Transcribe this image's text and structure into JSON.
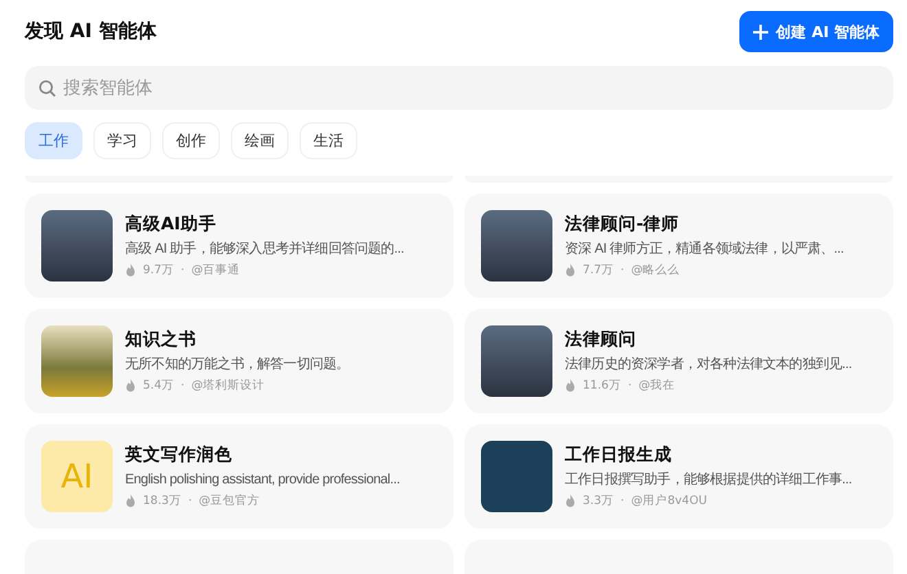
{
  "header": {
    "title": "发现 AI 智能体",
    "create_button": "创建 AI 智能体"
  },
  "search": {
    "placeholder": "搜索智能体"
  },
  "tabs": [
    {
      "label": "工作",
      "selected": true
    },
    {
      "label": "学习",
      "selected": false
    },
    {
      "label": "创作",
      "selected": false
    },
    {
      "label": "绘画",
      "selected": false
    },
    {
      "label": "生活",
      "selected": false
    }
  ],
  "agents": [
    {
      "kind": "photo",
      "title": "高级AI助手",
      "description": "高级 AI 助手，能够深入思考并详细回答问题的...",
      "uses": "9.7万",
      "separator": "·",
      "author": "@百事通"
    },
    {
      "kind": "photo",
      "title": "法律顾问-律师",
      "description": "资深 AI 律师方正，精通各领域法律，以严肃、...",
      "uses": "7.7万",
      "separator": "·",
      "author": "@略么么"
    },
    {
      "kind": "landscape",
      "title": "知识之书",
      "description": "无所不知的万能之书，解答一切问题。",
      "uses": "5.4万",
      "separator": "·",
      "author": "@塔利斯设计"
    },
    {
      "kind": "photo",
      "title": "法律顾问",
      "description": "法律历史的资深学者，对各种法律文本的独到见...",
      "uses": "11.6万",
      "separator": "·",
      "author": "@我在"
    },
    {
      "kind": "logo",
      "logo_text": "AI",
      "title": "英文写作润色",
      "description": "English polishing assistant, provide professional...",
      "uses": "18.3万",
      "separator": "·",
      "author": "@豆包官方"
    },
    {
      "kind": "robot",
      "title": "工作日报生成",
      "description": "工作日报撰写助手，能够根据提供的详细工作事...",
      "uses": "3.3万",
      "separator": "·",
      "author": "@用户8v4OU"
    }
  ]
}
